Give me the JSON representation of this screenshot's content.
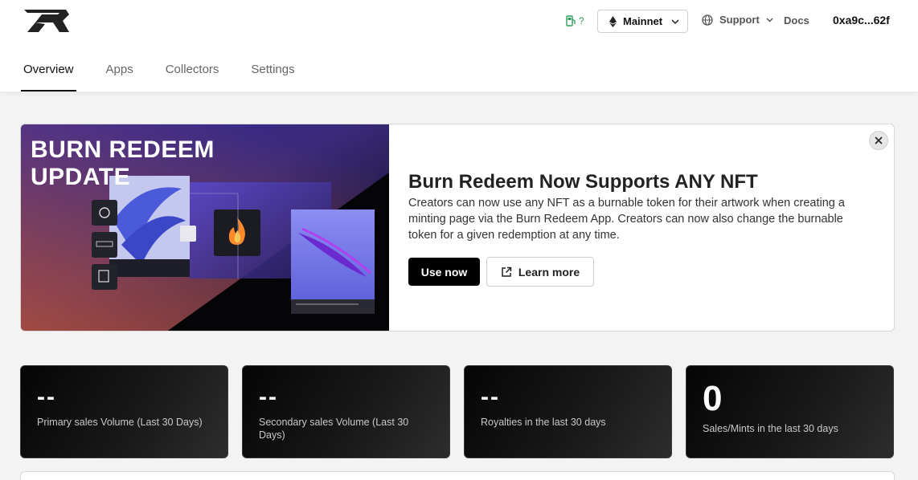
{
  "header": {
    "gas_label": "?",
    "network": "Mainnet",
    "support": "Support",
    "docs": "Docs",
    "wallet": "0xa9c...62f"
  },
  "tabs": [
    {
      "label": "Overview",
      "active": true
    },
    {
      "label": "Apps"
    },
    {
      "label": "Collectors"
    },
    {
      "label": "Settings"
    }
  ],
  "banner": {
    "image_title_line1": "BURN REDEEM",
    "image_title_line2": "UPDATE",
    "heading": "Burn Redeem Now Supports ANY NFT",
    "body": "Creators can now use any NFT as a burnable token for their artwork when creating a minting page via the Burn Redeem App. Creators can now also change the burnable token for a given redemption at any time.",
    "primary_button": "Use now",
    "secondary_button": "Learn more"
  },
  "stats": [
    {
      "value": "--",
      "label": "Primary sales Volume (Last 30 Days)"
    },
    {
      "value": "--",
      "label": "Secondary sales Volume (Last 30 Days)"
    },
    {
      "value": "--",
      "label": "Royalties in the last 30 days"
    },
    {
      "value": "0",
      "label": "Sales/Mints in the last 30 days"
    }
  ],
  "colors": {
    "accent": "#000000",
    "gas_green": "#2e9d5e",
    "stat_card_bg": "#0a0a0a"
  }
}
